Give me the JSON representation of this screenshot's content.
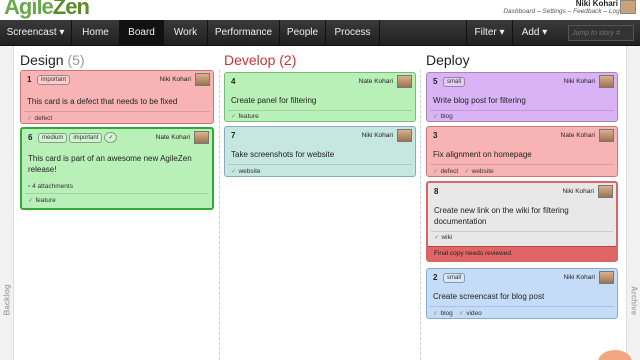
{
  "header": {
    "logo_agile": "Agile",
    "logo_zen": "Zen",
    "user_name": "Niki Kohari",
    "user_links": "Dashboard – Settings – Feedback – Log Out"
  },
  "nav": {
    "project": "Screencast ▾",
    "home": "Home",
    "board": "Board",
    "work": "Work",
    "performance": "Performance",
    "people": "People",
    "process": "Process",
    "filter": "Filter ▾",
    "add": "Add ▾",
    "jump_placeholder": "Jump to story #"
  },
  "side": {
    "backlog": "Backlog",
    "archive": "Archive"
  },
  "columns": [
    {
      "title": "Design",
      "count": "(5)",
      "cards": [
        {
          "num": "1",
          "tags": [
            "important"
          ],
          "owner": "Niki Kohari",
          "text": "This card is a defect that needs to be fixed",
          "labels": [
            "defect"
          ]
        },
        {
          "num": "6",
          "tags": [
            "medium",
            "important",
            "✓"
          ],
          "owner": "Nate Kohari",
          "text_line1": "This card is part of an awesome new AgileZen",
          "text_line2": "release!",
          "attachments": "4 attachments",
          "labels": [
            "feature"
          ]
        }
      ]
    },
    {
      "title": "Develop",
      "count": "(2)",
      "cards": [
        {
          "num": "4",
          "owner": "Nate Kohari",
          "text": "Create panel for filtering",
          "labels": [
            "feature"
          ]
        },
        {
          "num": "7",
          "owner": "Niki Kohari",
          "text": "Take screenshots for website",
          "labels": [
            "website"
          ]
        }
      ]
    },
    {
      "title": "Deploy",
      "cards": [
        {
          "num": "5",
          "tags": [
            "small"
          ],
          "owner": "Niki Kohari",
          "text": "Write blog post for filtering",
          "labels": [
            "blog"
          ]
        },
        {
          "num": "3",
          "owner": "Nate Kohari",
          "text": "Fix alignment on homepage",
          "labels": [
            "defect",
            "website"
          ]
        },
        {
          "num": "8",
          "owner": "Niki Kohari",
          "text_line1": "Create new link on the wiki for filtering",
          "text_line2": "documentation",
          "labels": [
            "wiki"
          ],
          "note": "Final copy needs reviewed."
        },
        {
          "num": "2",
          "tags": [
            "small"
          ],
          "owner": "Niki Kohari",
          "text": "Create screencast for blog post",
          "labels": [
            "blog",
            "video"
          ]
        }
      ]
    }
  ],
  "colors": {
    "pink": "#f8b4b4",
    "green": "#b8f0b8",
    "teal": "#c6e6e0",
    "purple": "#d9b3f5",
    "gray": "#e8e8e8",
    "blue": "#c4dcf8",
    "develop_title": "#cc3333"
  }
}
